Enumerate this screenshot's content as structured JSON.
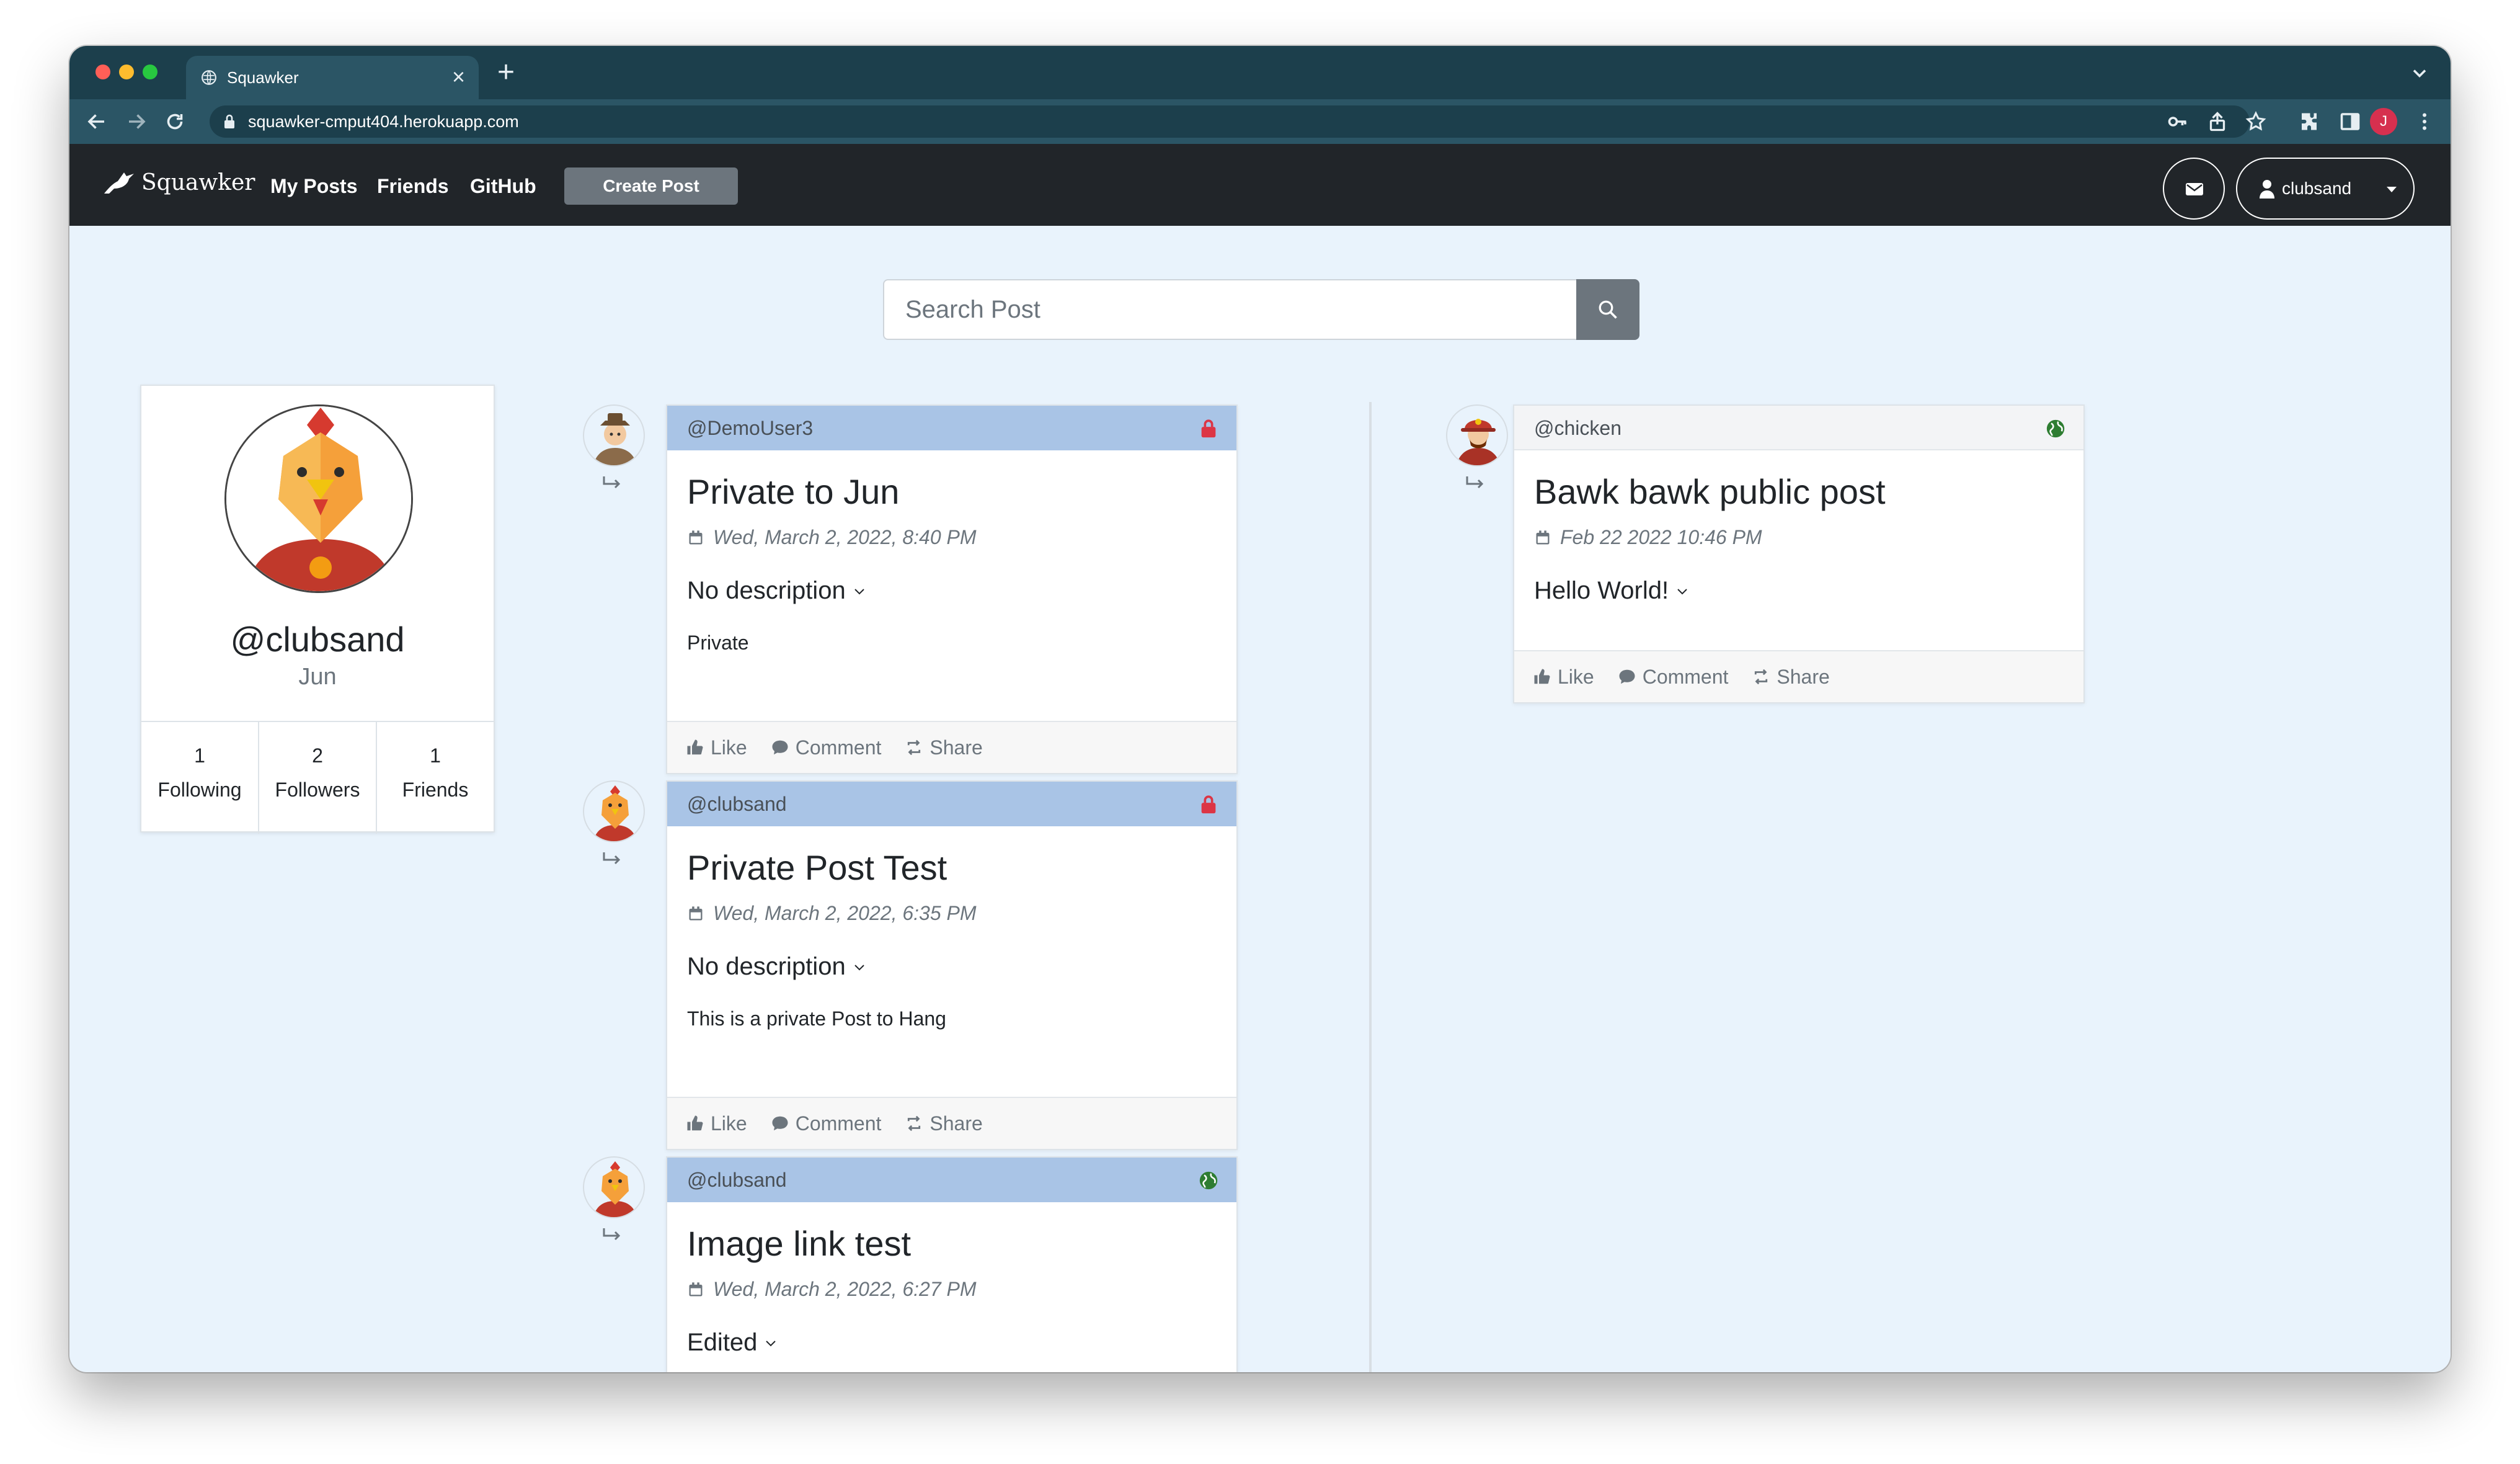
{
  "browser": {
    "tab_title": "Squawker",
    "url": "squawker-cmput404.herokuapp.com",
    "profile_initial": "J"
  },
  "navbar": {
    "brand": "Squawker",
    "links": [
      "My Posts",
      "Friends",
      "GitHub"
    ],
    "create_button": "Create Post",
    "user_label": "clubsand"
  },
  "search": {
    "placeholder": "Search Post"
  },
  "profile": {
    "handle": "@clubsand",
    "name": "Jun",
    "stats": [
      {
        "value": "1",
        "label": "Following"
      },
      {
        "value": "2",
        "label": "Followers"
      },
      {
        "value": "1",
        "label": "Friends"
      }
    ]
  },
  "posts": [
    {
      "user": "@DemoUser3",
      "visibility": "lock-icon",
      "title": "Private to Jun",
      "date": "Wed, March 2, 2022, 8:40 PM",
      "description": "No description",
      "body": "Private"
    },
    {
      "user": "@clubsand",
      "visibility": "lock-icon",
      "title": "Private Post Test",
      "date": "Wed, March 2, 2022, 6:35 PM",
      "description": "No description",
      "body": "This is a private Post to Hang"
    },
    {
      "user": "@clubsand",
      "visibility": "globe-icon",
      "title": "Image link test",
      "date": "Wed, March 2, 2022, 6:27 PM",
      "description": "Edited",
      "body": ""
    },
    {
      "user": "@chicken",
      "visibility": "globe-icon",
      "title": "Bawk bawk public post",
      "date": "Feb 22 2022 10:46 PM",
      "description": "Hello World!",
      "body": ""
    }
  ],
  "actions": {
    "like": "Like",
    "comment": "Comment",
    "share": "Share"
  },
  "colors": {
    "page_bg": "#e9f3fc",
    "navbar_bg": "#212529",
    "post_header_private": "#a9c4e6",
    "lock_red": "#dc3545",
    "globe_green": "#2e7d32"
  }
}
